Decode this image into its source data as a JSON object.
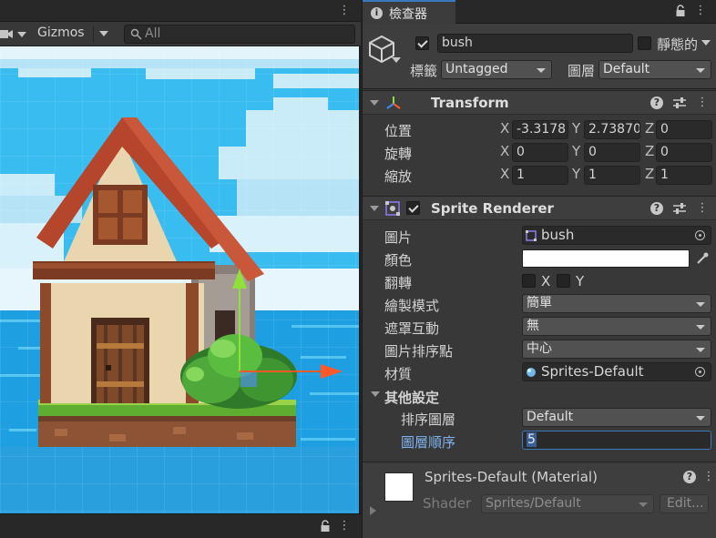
{
  "scene": {
    "gizmos_label": "Gizmos",
    "search_placeholder": "All"
  },
  "inspector": {
    "tab_label": "檢查器",
    "gameobject": {
      "name": "bush",
      "active": true,
      "static_label": "靜態的",
      "tag_label": "標籤",
      "tag_value": "Untagged",
      "layer_label": "圖層",
      "layer_value": "Default"
    },
    "transform": {
      "title": "Transform",
      "rows": [
        {
          "label": "位置",
          "x": "-3.3178",
          "y": "2.73870",
          "z": "0"
        },
        {
          "label": "旋轉",
          "x": "0",
          "y": "0",
          "z": "0"
        },
        {
          "label": "縮放",
          "x": "1",
          "y": "1",
          "z": "1"
        }
      ],
      "axis_x": "X",
      "axis_y": "Y",
      "axis_z": "Z"
    },
    "sprite_renderer": {
      "title": "Sprite Renderer",
      "enabled": true,
      "sprite_label": "圖片",
      "sprite_value": "bush",
      "color_label": "顏色",
      "color_value": "#ffffff",
      "flip_label": "翻轉",
      "flip_x": "X",
      "flip_y": "Y",
      "draw_mode_label": "繪製模式",
      "draw_mode_value": "簡單",
      "mask_label": "遮罩互動",
      "mask_value": "無",
      "sort_point_label": "圖片排序點",
      "sort_point_value": "中心",
      "material_label": "材質",
      "material_value": "Sprites-Default",
      "additional_label": "其他設定",
      "sorting_layer_label": "排序圖層",
      "sorting_layer_value": "Default",
      "order_label": "圖層順序",
      "order_value": "5"
    },
    "material": {
      "name": "Sprites-Default (Material)",
      "shader_label": "Shader",
      "shader_value": "Sprites/Default",
      "edit_label": "Edit..."
    }
  },
  "colors": {
    "accent": "#3a79bb",
    "sky": "#39bdf0",
    "sea": "#1e9fe2"
  }
}
